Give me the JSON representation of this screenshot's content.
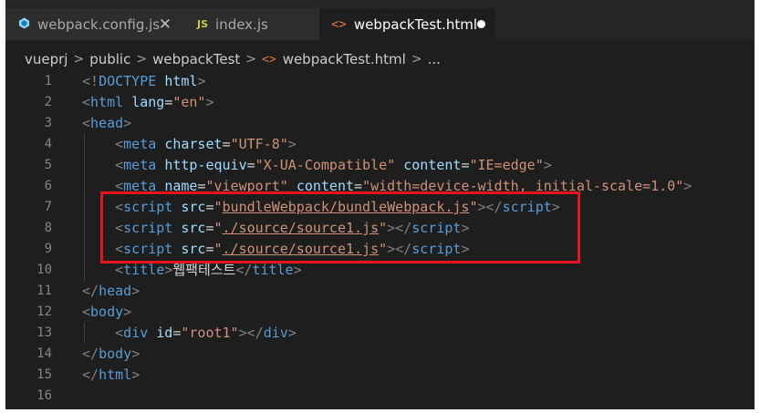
{
  "tabs": [
    {
      "label": "webpack.config.js",
      "icon": "webpack-icon",
      "active": false,
      "close": "✕"
    },
    {
      "label": "index.js",
      "icon": "js-icon",
      "icon_text": "JS",
      "active": false
    },
    {
      "label": "webpackTest.html",
      "icon": "html-icon",
      "icon_text": "<>",
      "active": true,
      "modified": true
    }
  ],
  "breadcrumb": {
    "items": [
      "vueprj",
      "public",
      "webpackTest",
      "webpackTest.html",
      "..."
    ],
    "sep": ">",
    "file_icon": "<>"
  },
  "highlight_color": "#e8141d",
  "lines": [
    {
      "n": "1",
      "tokens": [
        [
          "p",
          "<!"
        ],
        [
          "t",
          "DOCTYPE"
        ],
        [
          "o",
          " "
        ],
        [
          "a",
          "html"
        ],
        [
          "p",
          ">"
        ]
      ]
    },
    {
      "n": "2",
      "tokens": [
        [
          "p",
          "<"
        ],
        [
          "t",
          "html"
        ],
        [
          "o",
          " "
        ],
        [
          "a",
          "lang"
        ],
        [
          "o",
          "="
        ],
        [
          "s",
          "\"en\""
        ],
        [
          "p",
          ">"
        ]
      ]
    },
    {
      "n": "3",
      "tokens": [
        [
          "p",
          "<"
        ],
        [
          "t",
          "head"
        ],
        [
          "p",
          ">"
        ]
      ]
    },
    {
      "n": "4",
      "tokens": [
        [
          "o",
          "    "
        ],
        [
          "p",
          "<"
        ],
        [
          "t",
          "meta"
        ],
        [
          "o",
          " "
        ],
        [
          "a",
          "charset"
        ],
        [
          "o",
          "="
        ],
        [
          "s",
          "\"UTF-8\""
        ],
        [
          "p",
          ">"
        ]
      ]
    },
    {
      "n": "5",
      "tokens": [
        [
          "o",
          "    "
        ],
        [
          "p",
          "<"
        ],
        [
          "t",
          "meta"
        ],
        [
          "o",
          " "
        ],
        [
          "a",
          "http-equiv"
        ],
        [
          "o",
          "="
        ],
        [
          "s",
          "\"X-UA-Compatible\""
        ],
        [
          "o",
          " "
        ],
        [
          "a",
          "content"
        ],
        [
          "o",
          "="
        ],
        [
          "s",
          "\"IE=edge\""
        ],
        [
          "p",
          ">"
        ]
      ]
    },
    {
      "n": "6",
      "tokens": [
        [
          "o",
          "    "
        ],
        [
          "p",
          "<"
        ],
        [
          "t",
          "meta"
        ],
        [
          "o",
          " "
        ],
        [
          "a",
          "name"
        ],
        [
          "o",
          "="
        ],
        [
          "s",
          "\"viewport\""
        ],
        [
          "o",
          " "
        ],
        [
          "a",
          "content"
        ],
        [
          "o",
          "="
        ],
        [
          "s",
          "\"width=device-width, initial-scale=1.0\""
        ],
        [
          "p",
          ">"
        ]
      ]
    },
    {
      "n": "7",
      "tokens": [
        [
          "o",
          "    "
        ],
        [
          "p",
          "<"
        ],
        [
          "t",
          "script"
        ],
        [
          "o",
          " "
        ],
        [
          "a",
          "src"
        ],
        [
          "o",
          "="
        ],
        [
          "s",
          "\""
        ],
        [
          "su",
          "bundleWebpack/bundleWebpack.js"
        ],
        [
          "s",
          "\""
        ],
        [
          "p",
          ">"
        ],
        [
          "p",
          "</"
        ],
        [
          "t",
          "script"
        ],
        [
          "p",
          ">"
        ]
      ]
    },
    {
      "n": "8",
      "tokens": [
        [
          "o",
          "    "
        ],
        [
          "p",
          "<"
        ],
        [
          "t",
          "script"
        ],
        [
          "o",
          " "
        ],
        [
          "a",
          "src"
        ],
        [
          "o",
          "="
        ],
        [
          "s",
          "\""
        ],
        [
          "su",
          "./source/source1.js"
        ],
        [
          "s",
          "\""
        ],
        [
          "p",
          ">"
        ],
        [
          "p",
          "</"
        ],
        [
          "t",
          "script"
        ],
        [
          "p",
          ">"
        ]
      ]
    },
    {
      "n": "9",
      "tokens": [
        [
          "o",
          "    "
        ],
        [
          "p",
          "<"
        ],
        [
          "t",
          "script"
        ],
        [
          "o",
          " "
        ],
        [
          "a",
          "src"
        ],
        [
          "o",
          "="
        ],
        [
          "s",
          "\""
        ],
        [
          "su",
          "./source/source1.js"
        ],
        [
          "s",
          "\""
        ],
        [
          "p",
          ">"
        ],
        [
          "p",
          "</"
        ],
        [
          "t",
          "script"
        ],
        [
          "p",
          ">"
        ]
      ]
    },
    {
      "n": "10",
      "tokens": [
        [
          "o",
          "    "
        ],
        [
          "p",
          "<"
        ],
        [
          "t",
          "title"
        ],
        [
          "p",
          ">"
        ],
        [
          "o",
          "웹팩테스트"
        ],
        [
          "p",
          "</"
        ],
        [
          "t",
          "title"
        ],
        [
          "p",
          ">"
        ]
      ]
    },
    {
      "n": "11",
      "tokens": [
        [
          "p",
          "</"
        ],
        [
          "t",
          "head"
        ],
        [
          "p",
          ">"
        ]
      ]
    },
    {
      "n": "12",
      "tokens": [
        [
          "p",
          "<"
        ],
        [
          "t",
          "body"
        ],
        [
          "p",
          ">"
        ]
      ]
    },
    {
      "n": "13",
      "tokens": [
        [
          "o",
          "    "
        ],
        [
          "p",
          "<"
        ],
        [
          "t",
          "div"
        ],
        [
          "o",
          " "
        ],
        [
          "a",
          "id"
        ],
        [
          "o",
          "="
        ],
        [
          "s",
          "\"root1\""
        ],
        [
          "p",
          ">"
        ],
        [
          "p",
          "</"
        ],
        [
          "t",
          "div"
        ],
        [
          "p",
          ">"
        ]
      ]
    },
    {
      "n": "14",
      "tokens": [
        [
          "p",
          "</"
        ],
        [
          "t",
          "body"
        ],
        [
          "p",
          ">"
        ]
      ]
    },
    {
      "n": "15",
      "tokens": [
        [
          "p",
          "</"
        ],
        [
          "t",
          "html"
        ],
        [
          "p",
          ">"
        ]
      ]
    },
    {
      "n": "16",
      "tokens": []
    }
  ]
}
